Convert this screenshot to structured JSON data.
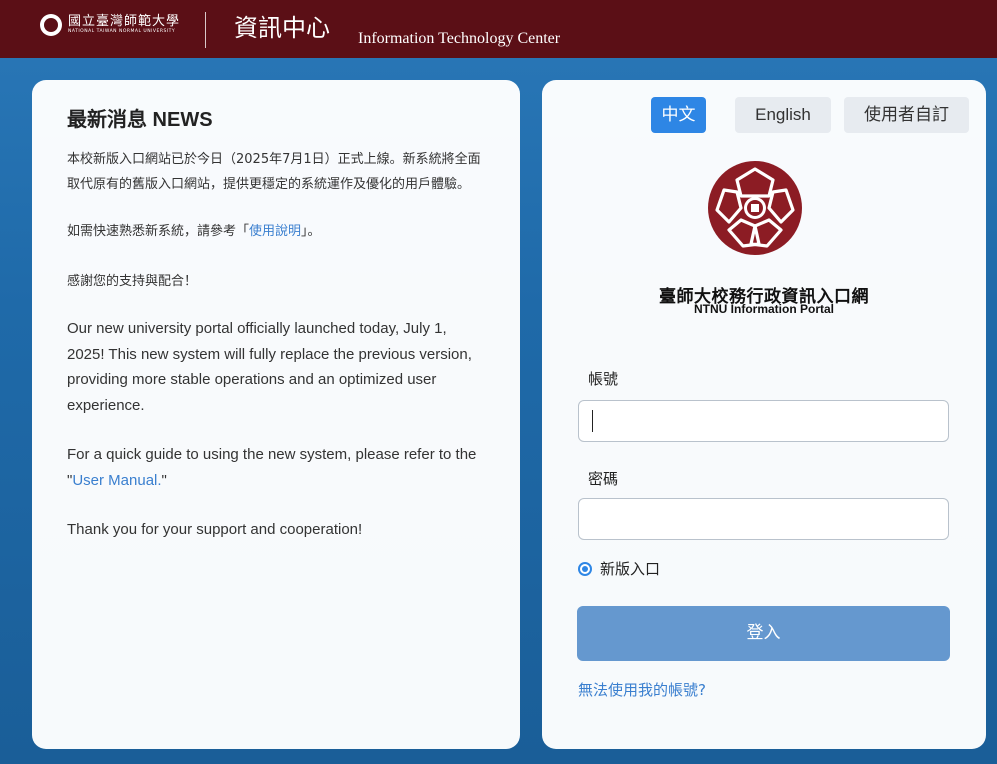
{
  "header": {
    "university_name_zh": "國立臺灣師範大學",
    "university_name_en": "NATIONAL TAIWAN NORMAL UNIVERSITY",
    "center_name_zh": "資訊中心",
    "center_name_en": "Information Technology Center"
  },
  "news": {
    "title": "最新消息 NEWS",
    "zh_p1": "本校新版入口網站已於今日（2025年7月1日）正式上線。新系統將全面取代原有的舊版入口網站，提供更穩定的系統運作及優化的用戶體驗。",
    "zh_p2_before": "如需快速熟悉新系統，請參考「",
    "zh_p2_link": "使用說明",
    "zh_p2_after": "」。",
    "zh_p3": "感謝您的支持與配合！",
    "en_p1": "Our new university portal officially launched today, July 1, 2025! This new system will fully replace the previous version, providing more stable operations and an optimized user experience.",
    "en_p2_before": "For a quick guide to using the new system, please refer to the \"",
    "en_p2_link": "User Manual.",
    "en_p2_after": "\"",
    "en_p3": "Thank you for your support and cooperation!"
  },
  "login": {
    "lang_zh": "中文",
    "lang_en": "English",
    "lang_custom": "使用者自訂",
    "portal_name_zh": "臺師大校務行政資訊入口網",
    "portal_name_en": "NTNU Information Portal",
    "account_label": "帳號",
    "account_value": "",
    "password_label": "密碼",
    "password_value": "",
    "radio_option": "新版入口",
    "submit": "登入",
    "help_link": "無法使用我的帳號?"
  },
  "colors": {
    "header_bg": "#5b0f16",
    "primary": "#2e86e5",
    "login_button": "#6598cf",
    "logo_red": "#8c1c24"
  }
}
